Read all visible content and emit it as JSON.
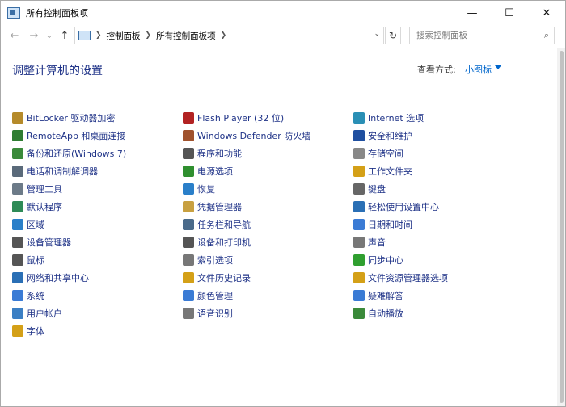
{
  "window": {
    "title": "所有控制面板项"
  },
  "controls": {
    "minimize": "—",
    "maximize": "☐",
    "close": "✕"
  },
  "nav": {
    "back": "←",
    "forward": "→",
    "recent": "⌄",
    "up": "↑"
  },
  "breadcrumb": [
    "控制面板",
    "所有控制面板项"
  ],
  "search": {
    "placeholder": "搜索控制面板"
  },
  "header": {
    "title": "调整计算机的设置",
    "view_by_label": "查看方式:",
    "view_by_value": "小图标"
  },
  "columns": [
    [
      {
        "label": "BitLocker 驱动器加密",
        "icon": "bitlocker-icon",
        "color": "#b58a2a"
      },
      {
        "label": "RemoteApp 和桌面连接",
        "icon": "remoteapp-icon",
        "color": "#2f7d32"
      },
      {
        "label": "备份和还原(Windows 7)",
        "icon": "backup-icon",
        "color": "#3a8a3a"
      },
      {
        "label": "电话和调制解调器",
        "icon": "modem-icon",
        "color": "#5a6a7a"
      },
      {
        "label": "管理工具",
        "icon": "admin-tools-icon",
        "color": "#6c7a88"
      },
      {
        "label": "默认程序",
        "icon": "default-programs-icon",
        "color": "#2e8b57"
      },
      {
        "label": "区域",
        "icon": "region-icon",
        "color": "#2a7fc9"
      },
      {
        "label": "设备管理器",
        "icon": "device-manager-icon",
        "color": "#555555"
      },
      {
        "label": "鼠标",
        "icon": "mouse-icon",
        "color": "#555555"
      },
      {
        "label": "网络和共享中心",
        "icon": "network-icon",
        "color": "#2a6fb5"
      },
      {
        "label": "系统",
        "icon": "system-icon",
        "color": "#3a7bd5"
      },
      {
        "label": "用户帐户",
        "icon": "user-accounts-icon",
        "color": "#3b7fc4"
      },
      {
        "label": "字体",
        "icon": "fonts-icon",
        "color": "#d4a017"
      }
    ],
    [
      {
        "label": "Flash Player (32 位)",
        "icon": "flash-icon",
        "color": "#b22222"
      },
      {
        "label": "Windows Defender 防火墙",
        "icon": "firewall-icon",
        "color": "#a0522d"
      },
      {
        "label": "程序和功能",
        "icon": "programs-icon",
        "color": "#555555"
      },
      {
        "label": "电源选项",
        "icon": "power-icon",
        "color": "#2f8f2f"
      },
      {
        "label": "恢复",
        "icon": "recovery-icon",
        "color": "#2a7fc9"
      },
      {
        "label": "凭据管理器",
        "icon": "credentials-icon",
        "color": "#c8a040"
      },
      {
        "label": "任务栏和导航",
        "icon": "taskbar-icon",
        "color": "#4a6a8a"
      },
      {
        "label": "设备和打印机",
        "icon": "printer-icon",
        "color": "#555555"
      },
      {
        "label": "索引选项",
        "icon": "indexing-icon",
        "color": "#777777"
      },
      {
        "label": "文件历史记录",
        "icon": "file-history-icon",
        "color": "#d4a017"
      },
      {
        "label": "颜色管理",
        "icon": "color-icon",
        "color": "#3a7bd5"
      },
      {
        "label": "语音识别",
        "icon": "speech-icon",
        "color": "#777777"
      }
    ],
    [
      {
        "label": "Internet 选项",
        "icon": "internet-icon",
        "color": "#2a8fb5"
      },
      {
        "label": "安全和维护",
        "icon": "security-flag-icon",
        "color": "#1f4fa0"
      },
      {
        "label": "存储空间",
        "icon": "storage-icon",
        "color": "#888888"
      },
      {
        "label": "工作文件夹",
        "icon": "work-folders-icon",
        "color": "#d4a017"
      },
      {
        "label": "键盘",
        "icon": "keyboard-icon",
        "color": "#666666"
      },
      {
        "label": "轻松使用设置中心",
        "icon": "ease-of-access-icon",
        "color": "#2a6fb5"
      },
      {
        "label": "日期和时间",
        "icon": "clock-icon",
        "color": "#3a7bd5"
      },
      {
        "label": "声音",
        "icon": "sound-icon",
        "color": "#777777"
      },
      {
        "label": "同步中心",
        "icon": "sync-icon",
        "color": "#2f9f2f"
      },
      {
        "label": "文件资源管理器选项",
        "icon": "folder-options-icon",
        "color": "#d4a017"
      },
      {
        "label": "疑难解答",
        "icon": "troubleshoot-icon",
        "color": "#3a7bd5"
      },
      {
        "label": "自动播放",
        "icon": "autoplay-icon",
        "color": "#3a8a3a"
      }
    ]
  ]
}
